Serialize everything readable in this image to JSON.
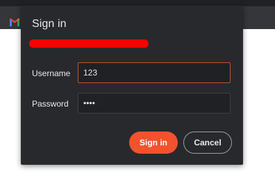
{
  "browser": {
    "favicon_icon": "gmail-icon"
  },
  "dialog": {
    "title": "Sign in",
    "site_url_redacted": true,
    "username_label": "Username",
    "username_value": "123",
    "password_label": "Password",
    "password_value": "••••",
    "signin_label": "Sign in",
    "cancel_label": "Cancel"
  },
  "colors": {
    "dialog_bg": "#28292c",
    "accent": "#f2522e",
    "focus_border": "#c0552f",
    "redaction": "#ff0000"
  }
}
